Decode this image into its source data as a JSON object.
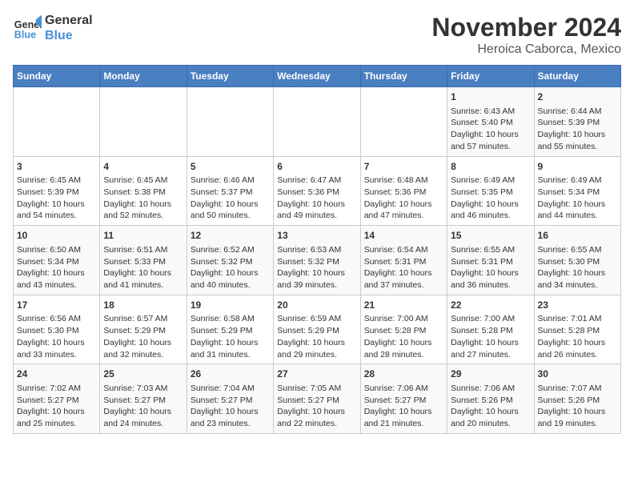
{
  "header": {
    "logo_line1": "General",
    "logo_line2": "Blue",
    "month": "November 2024",
    "location": "Heroica Caborca, Mexico"
  },
  "days_of_week": [
    "Sunday",
    "Monday",
    "Tuesday",
    "Wednesday",
    "Thursday",
    "Friday",
    "Saturday"
  ],
  "weeks": [
    [
      {
        "day": "",
        "info": ""
      },
      {
        "day": "",
        "info": ""
      },
      {
        "day": "",
        "info": ""
      },
      {
        "day": "",
        "info": ""
      },
      {
        "day": "",
        "info": ""
      },
      {
        "day": "1",
        "info": "Sunrise: 6:43 AM\nSunset: 5:40 PM\nDaylight: 10 hours and 57 minutes."
      },
      {
        "day": "2",
        "info": "Sunrise: 6:44 AM\nSunset: 5:39 PM\nDaylight: 10 hours and 55 minutes."
      }
    ],
    [
      {
        "day": "3",
        "info": "Sunrise: 6:45 AM\nSunset: 5:39 PM\nDaylight: 10 hours and 54 minutes."
      },
      {
        "day": "4",
        "info": "Sunrise: 6:45 AM\nSunset: 5:38 PM\nDaylight: 10 hours and 52 minutes."
      },
      {
        "day": "5",
        "info": "Sunrise: 6:46 AM\nSunset: 5:37 PM\nDaylight: 10 hours and 50 minutes."
      },
      {
        "day": "6",
        "info": "Sunrise: 6:47 AM\nSunset: 5:36 PM\nDaylight: 10 hours and 49 minutes."
      },
      {
        "day": "7",
        "info": "Sunrise: 6:48 AM\nSunset: 5:36 PM\nDaylight: 10 hours and 47 minutes."
      },
      {
        "day": "8",
        "info": "Sunrise: 6:49 AM\nSunset: 5:35 PM\nDaylight: 10 hours and 46 minutes."
      },
      {
        "day": "9",
        "info": "Sunrise: 6:49 AM\nSunset: 5:34 PM\nDaylight: 10 hours and 44 minutes."
      }
    ],
    [
      {
        "day": "10",
        "info": "Sunrise: 6:50 AM\nSunset: 5:34 PM\nDaylight: 10 hours and 43 minutes."
      },
      {
        "day": "11",
        "info": "Sunrise: 6:51 AM\nSunset: 5:33 PM\nDaylight: 10 hours and 41 minutes."
      },
      {
        "day": "12",
        "info": "Sunrise: 6:52 AM\nSunset: 5:32 PM\nDaylight: 10 hours and 40 minutes."
      },
      {
        "day": "13",
        "info": "Sunrise: 6:53 AM\nSunset: 5:32 PM\nDaylight: 10 hours and 39 minutes."
      },
      {
        "day": "14",
        "info": "Sunrise: 6:54 AM\nSunset: 5:31 PM\nDaylight: 10 hours and 37 minutes."
      },
      {
        "day": "15",
        "info": "Sunrise: 6:55 AM\nSunset: 5:31 PM\nDaylight: 10 hours and 36 minutes."
      },
      {
        "day": "16",
        "info": "Sunrise: 6:55 AM\nSunset: 5:30 PM\nDaylight: 10 hours and 34 minutes."
      }
    ],
    [
      {
        "day": "17",
        "info": "Sunrise: 6:56 AM\nSunset: 5:30 PM\nDaylight: 10 hours and 33 minutes."
      },
      {
        "day": "18",
        "info": "Sunrise: 6:57 AM\nSunset: 5:29 PM\nDaylight: 10 hours and 32 minutes."
      },
      {
        "day": "19",
        "info": "Sunrise: 6:58 AM\nSunset: 5:29 PM\nDaylight: 10 hours and 31 minutes."
      },
      {
        "day": "20",
        "info": "Sunrise: 6:59 AM\nSunset: 5:29 PM\nDaylight: 10 hours and 29 minutes."
      },
      {
        "day": "21",
        "info": "Sunrise: 7:00 AM\nSunset: 5:28 PM\nDaylight: 10 hours and 28 minutes."
      },
      {
        "day": "22",
        "info": "Sunrise: 7:00 AM\nSunset: 5:28 PM\nDaylight: 10 hours and 27 minutes."
      },
      {
        "day": "23",
        "info": "Sunrise: 7:01 AM\nSunset: 5:28 PM\nDaylight: 10 hours and 26 minutes."
      }
    ],
    [
      {
        "day": "24",
        "info": "Sunrise: 7:02 AM\nSunset: 5:27 PM\nDaylight: 10 hours and 25 minutes."
      },
      {
        "day": "25",
        "info": "Sunrise: 7:03 AM\nSunset: 5:27 PM\nDaylight: 10 hours and 24 minutes."
      },
      {
        "day": "26",
        "info": "Sunrise: 7:04 AM\nSunset: 5:27 PM\nDaylight: 10 hours and 23 minutes."
      },
      {
        "day": "27",
        "info": "Sunrise: 7:05 AM\nSunset: 5:27 PM\nDaylight: 10 hours and 22 minutes."
      },
      {
        "day": "28",
        "info": "Sunrise: 7:06 AM\nSunset: 5:27 PM\nDaylight: 10 hours and 21 minutes."
      },
      {
        "day": "29",
        "info": "Sunrise: 7:06 AM\nSunset: 5:26 PM\nDaylight: 10 hours and 20 minutes."
      },
      {
        "day": "30",
        "info": "Sunrise: 7:07 AM\nSunset: 5:26 PM\nDaylight: 10 hours and 19 minutes."
      }
    ]
  ]
}
